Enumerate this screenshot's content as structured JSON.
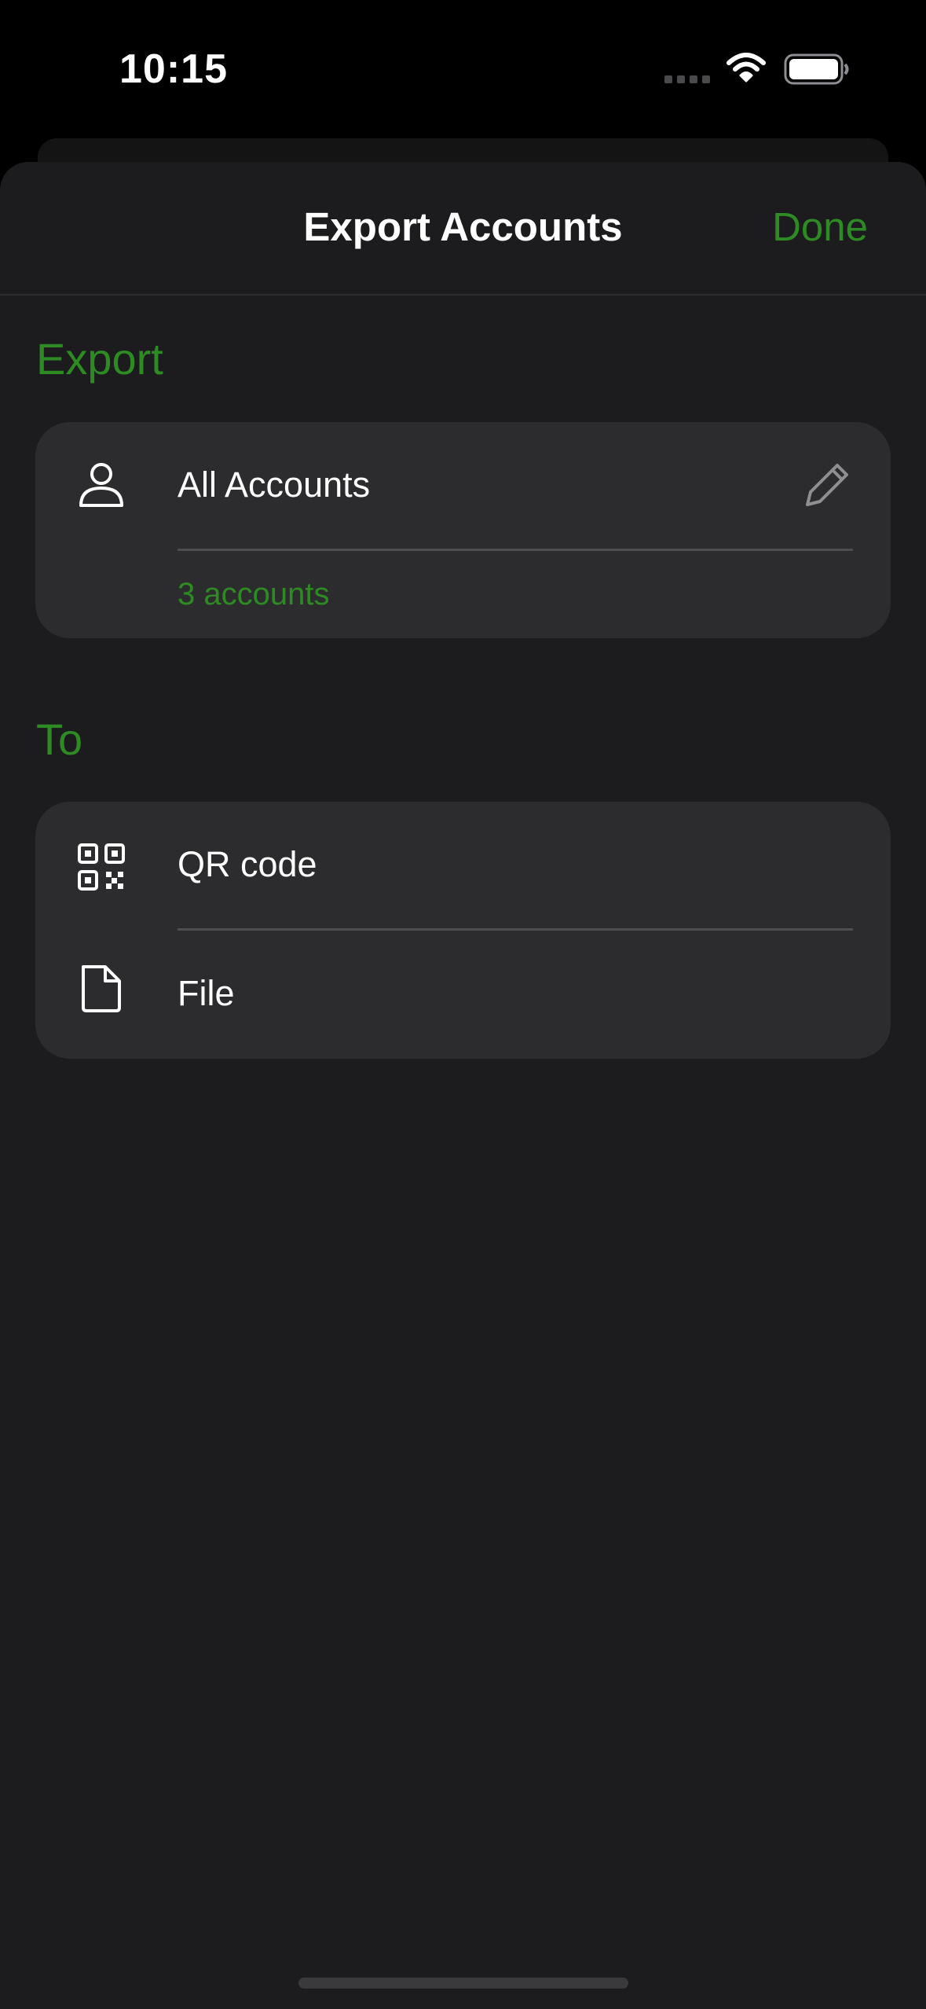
{
  "status_bar": {
    "time": "10:15"
  },
  "nav": {
    "title": "Export Accounts",
    "done_label": "Done"
  },
  "export_section": {
    "header": "Export",
    "accounts_row": {
      "label": "All Accounts",
      "count_text": "3 accounts",
      "icon": "person-icon",
      "action_icon": "pencil-icon"
    }
  },
  "to_section": {
    "header": "To",
    "items": [
      {
        "label": "QR code",
        "icon": "qr-code-icon"
      },
      {
        "label": "File",
        "icon": "document-icon"
      }
    ]
  },
  "colors": {
    "accent": "#2e8b24",
    "sheet_background": "#1c1c1e",
    "card_background": "#2c2c2e"
  }
}
